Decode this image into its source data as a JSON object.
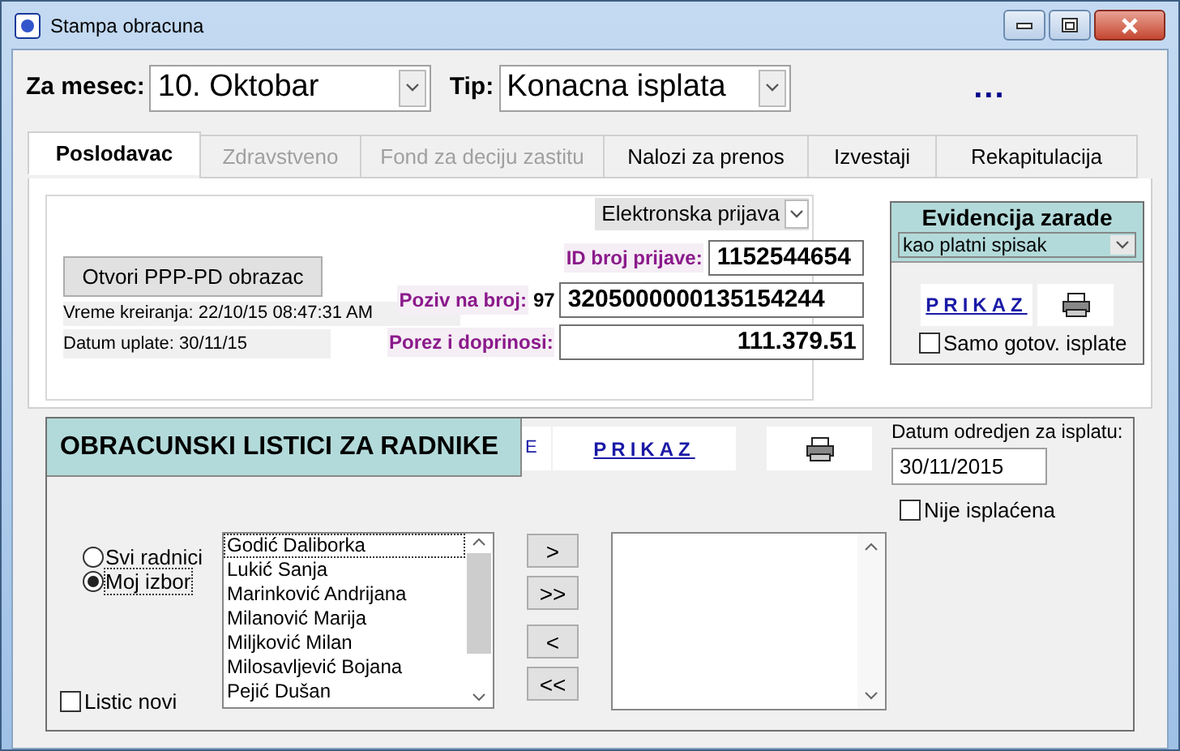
{
  "window": {
    "title": "Stampa obracuna"
  },
  "month": {
    "label": "Za mesec:",
    "value": "10. Oktobar"
  },
  "type": {
    "label": "Tip:",
    "value": "Konacna isplata"
  },
  "more": "...",
  "tabs": [
    {
      "label": "Poslodavac",
      "selected": true,
      "disabled": false
    },
    {
      "label": "Zdravstveno",
      "selected": false,
      "disabled": true
    },
    {
      "label": "Fond za deciju zastitu",
      "selected": false,
      "disabled": true
    },
    {
      "label": "Nalozi za prenos",
      "selected": false,
      "disabled": false
    },
    {
      "label": "Izvestaji",
      "selected": false,
      "disabled": false
    },
    {
      "label": "Rekapitulacija",
      "selected": false,
      "disabled": false
    }
  ],
  "employer": {
    "report_select": "Elektronska prijava",
    "open_button": "Otvori PPP-PD obrazac",
    "created": "Vreme kreiranja: 22/10/15 08:47:31 AM",
    "paid": "Datum uplate: 30/11/15",
    "fields": [
      {
        "label": "ID broj prijave:",
        "value": "1152544654"
      },
      {
        "label": "Poziv na broj:",
        "prefix": "97",
        "value": "3205000000135154244"
      },
      {
        "label": "Porez i doprinosi:",
        "value": "111.379.51"
      }
    ]
  },
  "earnings": {
    "title": "Evidencija zarade",
    "select": "kao platni spisak",
    "show_link": "PRIKAZ",
    "only_cash": {
      "label": "Samo gotov. isplate",
      "checked": false
    }
  },
  "payslips": {
    "title": "OBRACUNSKI LISTICI ZA RADNIKE",
    "marker": "E",
    "show_link": "PRIKAZ",
    "date_label": "Datum odredjen za isplatu:",
    "date": "30/11/2015",
    "not_paid": {
      "label": "Nije isplaćena",
      "checked": false
    },
    "scope": [
      {
        "label": "Svi radnici",
        "selected": false
      },
      {
        "label": "Moj izbor",
        "selected": true
      }
    ],
    "new_slip": {
      "label": "Listic novi",
      "checked": false
    },
    "employees": [
      {
        "name": "Godić Daliborka",
        "focused": true
      },
      {
        "name": "Lukić Sanja",
        "focused": false
      },
      {
        "name": "Marinković Andrijana",
        "focused": false
      },
      {
        "name": "Milanović Marija",
        "focused": false
      },
      {
        "name": "Miljković Milan",
        "focused": false
      },
      {
        "name": "Milosavljević Bojana",
        "focused": false
      },
      {
        "name": "Pejić Dušan",
        "focused": false
      }
    ],
    "move_buttons": [
      ">",
      ">>",
      "<",
      "<<"
    ]
  }
}
